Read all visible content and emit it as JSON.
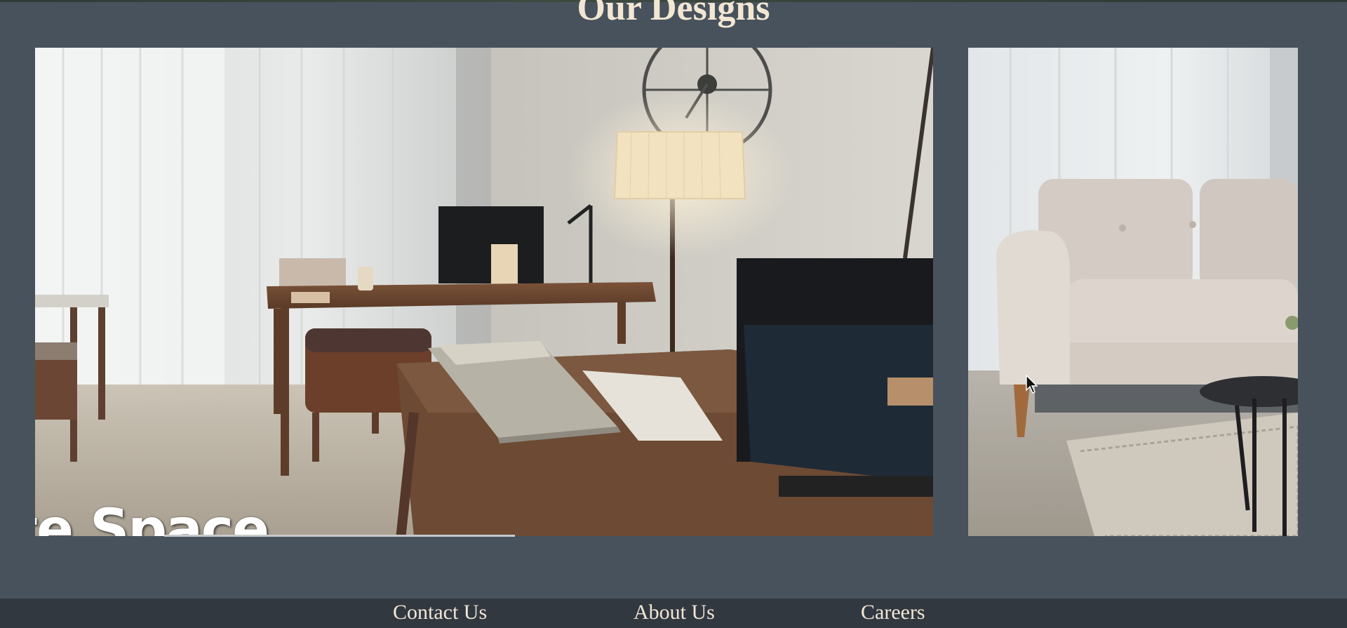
{
  "page": {
    "title": "Our Designs"
  },
  "carousel": {
    "slides": [
      {
        "caption": "ite Space",
        "subject": "home-office-room"
      },
      {
        "caption": "",
        "subject": "living-room-sofa"
      }
    ],
    "progress_fraction": 0.48
  },
  "footer": {
    "links": [
      {
        "label": "Contact Us"
      },
      {
        "label": "About Us"
      },
      {
        "label": "Careers"
      }
    ]
  },
  "colors": {
    "background": "#48525d",
    "footer_bg": "#313840",
    "title_text": "#f3e6d2",
    "footer_text": "#f2e6d6"
  },
  "icons": {
    "cursor": "mouse-pointer-icon"
  }
}
